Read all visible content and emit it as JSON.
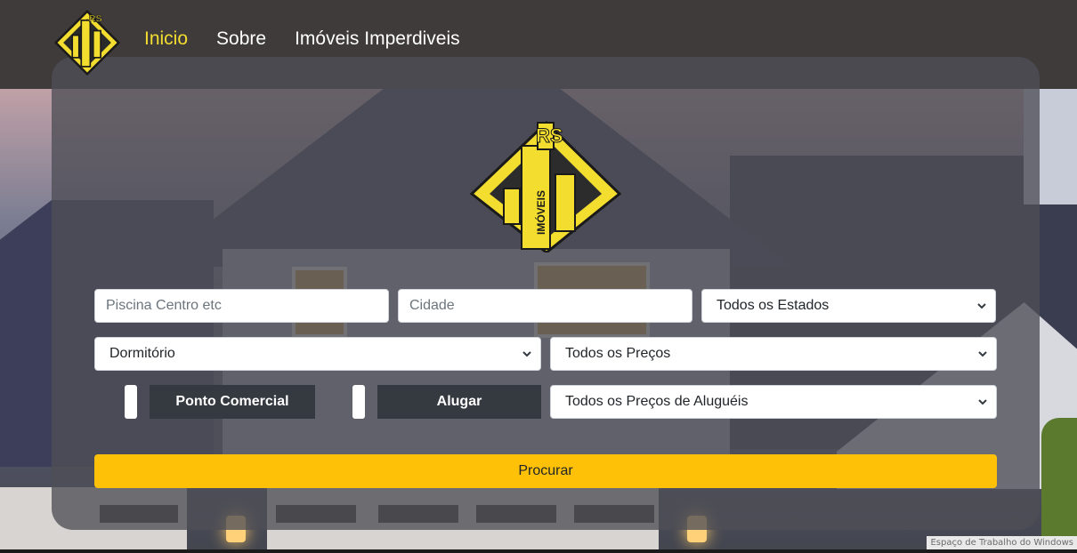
{
  "brand": {
    "logo_letters": "RS",
    "logo_word": "IMÓVEIS",
    "accent_color": "#f3dd2f",
    "logo_icon": "building-diamond-logo"
  },
  "nav": {
    "items": [
      {
        "label": "Inicio",
        "active": true
      },
      {
        "label": "Sobre",
        "active": false
      },
      {
        "label": "Imóveis Imperdiveis",
        "active": false
      }
    ]
  },
  "search": {
    "keyword_placeholder": "Piscina Centro etc",
    "city_placeholder": "Cidade",
    "state_selected": "Todos os Estados",
    "bedrooms_selected": "Dormitório",
    "price_selected": "Todos os Preços",
    "commercial_label": "Ponto Comercial",
    "rent_label": "Alugar",
    "rent_price_selected": "Todos os Preços de Aluguéis",
    "submit_label": "Procurar",
    "submit_color": "#ffc107"
  },
  "os": {
    "watermark": "Espaço de Trabalho do Windows"
  }
}
